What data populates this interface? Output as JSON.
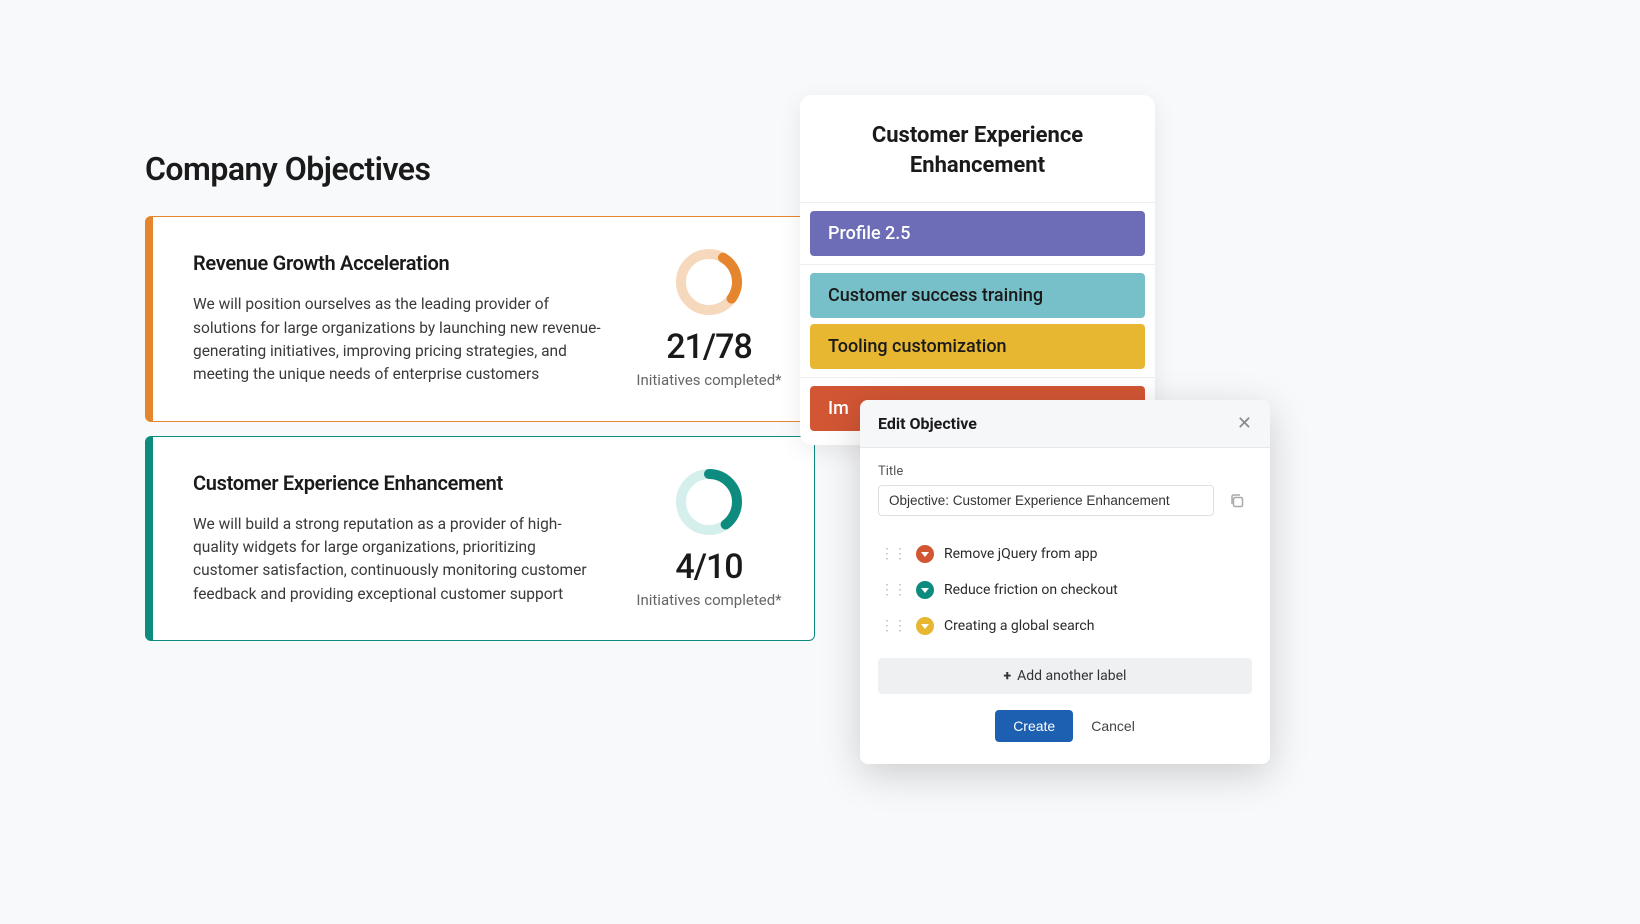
{
  "page_title": "Company Objectives",
  "objectives": [
    {
      "title": "Revenue Growth Acceleration",
      "desc": "We will position ourselves as the leading provider of solutions for large organizations by launching new revenue-generating initiatives, improving pricing strategies, and meeting the unique needs of enterprise customers",
      "count": "21/78",
      "count_label": "Initiatives completed*",
      "progress_pct": 27,
      "accent": "#e5862e"
    },
    {
      "title": "Customer Experience Enhancement",
      "desc": "We will build a strong reputation as a provider of high-quality widgets for large organizations, prioritizing customer satisfaction, continuously monitoring customer feedback and providing exceptional customer support",
      "count": "4/10",
      "count_label": "Initiatives completed*",
      "progress_pct": 40,
      "accent": "#0e8b7f"
    }
  ],
  "epic_card": {
    "header": "Customer Experience Enhancement",
    "groups": [
      {
        "pills": [
          {
            "label": "Profile 2.5",
            "color": "purple"
          }
        ]
      },
      {
        "pills": [
          {
            "label": "Customer success training",
            "color": "blue"
          },
          {
            "label": "Tooling customization",
            "color": "yellow"
          }
        ]
      },
      {
        "pills": [
          {
            "label": "Im",
            "color": "red"
          }
        ]
      }
    ]
  },
  "modal": {
    "header": "Edit Objective",
    "title_label": "Title",
    "title_value": "Objective: Customer Experience Enhancement",
    "items": [
      {
        "label": "Remove jQuery from app",
        "color": "red"
      },
      {
        "label": "Reduce friction on checkout",
        "color": "teal"
      },
      {
        "label": "Creating a global search",
        "color": "yellow"
      }
    ],
    "add_label": "Add another label",
    "create": "Create",
    "cancel": "Cancel"
  },
  "chart_data": [
    {
      "type": "donut",
      "title": "Revenue Growth Acceleration — initiatives completed",
      "value": 21,
      "total": 78,
      "pct": 27,
      "color": "#e5862e",
      "track": "#f6d9bd"
    },
    {
      "type": "donut",
      "title": "Customer Experience Enhancement — initiatives completed",
      "value": 4,
      "total": 10,
      "pct": 40,
      "color": "#0e8b7f",
      "track": "#d4efec"
    }
  ]
}
